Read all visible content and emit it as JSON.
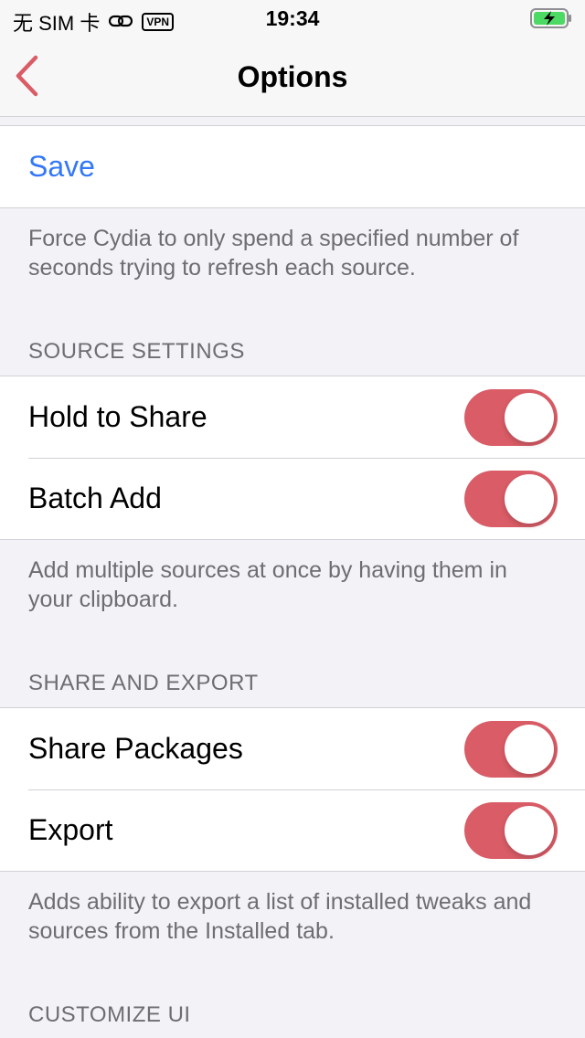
{
  "status_bar": {
    "carrier": "无 SIM 卡",
    "vpn": "VPN",
    "time": "19:34",
    "icons": [
      "link-icon",
      "battery-charging-icon"
    ]
  },
  "nav": {
    "title": "Options",
    "back_icon": "chevron-left-icon",
    "accent": "#d95c66"
  },
  "save_section": {
    "save_label": "Save",
    "footer": "Force Cydia to only spend a specified number of seconds trying to refresh each source."
  },
  "source_settings": {
    "header": "SOURCE SETTINGS",
    "rows": [
      {
        "label": "Hold to Share",
        "on": true
      },
      {
        "label": "Batch Add",
        "on": true
      }
    ],
    "footer": "Add multiple sources at once by having them in your clipboard."
  },
  "share_export": {
    "header": "SHARE AND EXPORT",
    "rows": [
      {
        "label": "Share Packages",
        "on": true
      },
      {
        "label": "Export",
        "on": true
      }
    ],
    "footer": "Adds ability to export a list of installed tweaks and sources from the Installed tab."
  },
  "customize_ui": {
    "header": "CUSTOMIZE UI"
  },
  "colors": {
    "toggle_on": "#d95c66",
    "link": "#3478f6",
    "background": "#f2f2f7"
  }
}
